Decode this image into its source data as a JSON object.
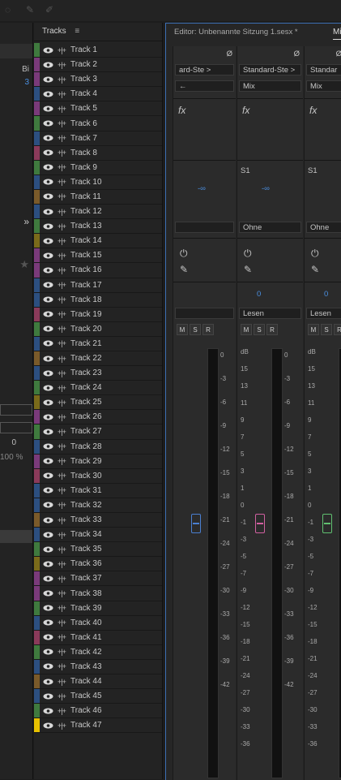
{
  "tracks_panel": {
    "title": "Tracks",
    "menu_icon": "hamburger-icon",
    "tracks": [
      {
        "name": "Track 1",
        "color": "#3f7a3e"
      },
      {
        "name": "Track 2",
        "color": "#7a3a7a"
      },
      {
        "name": "Track 3",
        "color": "#7a3a7a"
      },
      {
        "name": "Track 4",
        "color": "#2c4f80"
      },
      {
        "name": "Track 5",
        "color": "#7a3a7a"
      },
      {
        "name": "Track 6",
        "color": "#3f7a3e"
      },
      {
        "name": "Track 7",
        "color": "#2c4f80"
      },
      {
        "name": "Track 8",
        "color": "#8a3a5a"
      },
      {
        "name": "Track 9",
        "color": "#3f7a3e"
      },
      {
        "name": "Track 10",
        "color": "#2c4f80"
      },
      {
        "name": "Track 11",
        "color": "#7a5a2a"
      },
      {
        "name": "Track 12",
        "color": "#2c4f80"
      },
      {
        "name": "Track 13",
        "color": "#3f7a3e"
      },
      {
        "name": "Track 14",
        "color": "#7a6a1a"
      },
      {
        "name": "Track 15",
        "color": "#7a3a7a"
      },
      {
        "name": "Track 16",
        "color": "#7a3a7a"
      },
      {
        "name": "Track 17",
        "color": "#2c4f80"
      },
      {
        "name": "Track 18",
        "color": "#2c4f80"
      },
      {
        "name": "Track 19",
        "color": "#8a3a5a"
      },
      {
        "name": "Track 20",
        "color": "#3f7a3e"
      },
      {
        "name": "Track 21",
        "color": "#2c4f80"
      },
      {
        "name": "Track 22",
        "color": "#7a5a2a"
      },
      {
        "name": "Track 23",
        "color": "#2c4f80"
      },
      {
        "name": "Track 24",
        "color": "#3f7a3e"
      },
      {
        "name": "Track 25",
        "color": "#7a6a1a"
      },
      {
        "name": "Track 26",
        "color": "#7a3a7a"
      },
      {
        "name": "Track 27",
        "color": "#3f7a3e"
      },
      {
        "name": "Track 28",
        "color": "#2c4f80"
      },
      {
        "name": "Track 29",
        "color": "#7a3a7a"
      },
      {
        "name": "Track 30",
        "color": "#8a3a5a"
      },
      {
        "name": "Track 31",
        "color": "#2c4f80"
      },
      {
        "name": "Track 32",
        "color": "#2c4f80"
      },
      {
        "name": "Track 33",
        "color": "#7a5a2a"
      },
      {
        "name": "Track 34",
        "color": "#2c4f80"
      },
      {
        "name": "Track 35",
        "color": "#3f7a3e"
      },
      {
        "name": "Track 36",
        "color": "#7a6a1a"
      },
      {
        "name": "Track 37",
        "color": "#7a3a7a"
      },
      {
        "name": "Track 38",
        "color": "#7a3a7a"
      },
      {
        "name": "Track 39",
        "color": "#3f7a3e"
      },
      {
        "name": "Track 40",
        "color": "#2c4f80"
      },
      {
        "name": "Track 41",
        "color": "#8a3a5a"
      },
      {
        "name": "Track 42",
        "color": "#3f7a3e"
      },
      {
        "name": "Track 43",
        "color": "#2c4f80"
      },
      {
        "name": "Track 44",
        "color": "#7a5a2a"
      },
      {
        "name": "Track 45",
        "color": "#2c4f80"
      },
      {
        "name": "Track 46",
        "color": "#3f7a3e"
      },
      {
        "name": "Track 47",
        "color": "#e6c000"
      }
    ]
  },
  "editor": {
    "tab_title": "Editor: Unbenannte Sitzung 1.sesx *",
    "mixer_tab": "Mi",
    "phase_icon": "Ø",
    "strips": [
      {
        "input": "ard-Ste >",
        "output": "",
        "send": "",
        "read": "",
        "vol": "-∞",
        "pan_label": "",
        "fx_label": "fx",
        "send_name": "",
        "route": "",
        "scale": [
          "0",
          "-3",
          "-6",
          "-9",
          "-12",
          "-15",
          "-18",
          "-21",
          "-24",
          "-27",
          "-30",
          "-33",
          "-36",
          "-39",
          "-42"
        ],
        "fader_color": "#4a7fd0",
        "zero_val": ""
      },
      {
        "input": "Standard-Ste >",
        "output": "Mix",
        "send": "S1",
        "read": "Lesen",
        "vol": "-∞",
        "route": "Ohne",
        "fx_label": "fx",
        "zero_val": "0",
        "scale": [
          "0",
          "-3",
          "-6",
          "-9",
          "-12",
          "-15",
          "-18",
          "-21",
          "-24",
          "-27",
          "-30",
          "-33",
          "-36",
          "-39",
          "-42"
        ],
        "db_scale": [
          "dB",
          "15",
          "13",
          "11",
          "9",
          "7",
          "5",
          "3",
          "1",
          "0",
          "-1",
          "-3",
          "-5",
          "-7",
          "-9",
          "-12",
          "-15",
          "-18",
          "-21",
          "-24",
          "-27",
          "-30",
          "-33",
          "-36"
        ],
        "fader_color": "#d060a0"
      },
      {
        "input": "Standar",
        "output": "Mix",
        "send": "S1",
        "read": "Lesen",
        "vol": "",
        "route": "Ohne",
        "fx_label": "fx",
        "zero_val": "0",
        "db_scale": [
          "dB",
          "15",
          "13",
          "11",
          "9",
          "7",
          "5",
          "3",
          "1",
          "0",
          "-1",
          "-3",
          "-5",
          "-7",
          "-9",
          "-12",
          "-15",
          "-18",
          "-21",
          "-24",
          "-27",
          "-30",
          "-33",
          "-36"
        ],
        "fader_color": "#60c070"
      }
    ],
    "buttons": {
      "m": "M",
      "s": "S",
      "r": "R"
    },
    "left_panel": {
      "header_col": "Bi",
      "value": "3",
      "percent": "100 %",
      "zero": "0",
      "chevron": "»"
    }
  },
  "colors": {
    "accent_blue": "#3d6fb4",
    "record_red": "#c03030"
  }
}
